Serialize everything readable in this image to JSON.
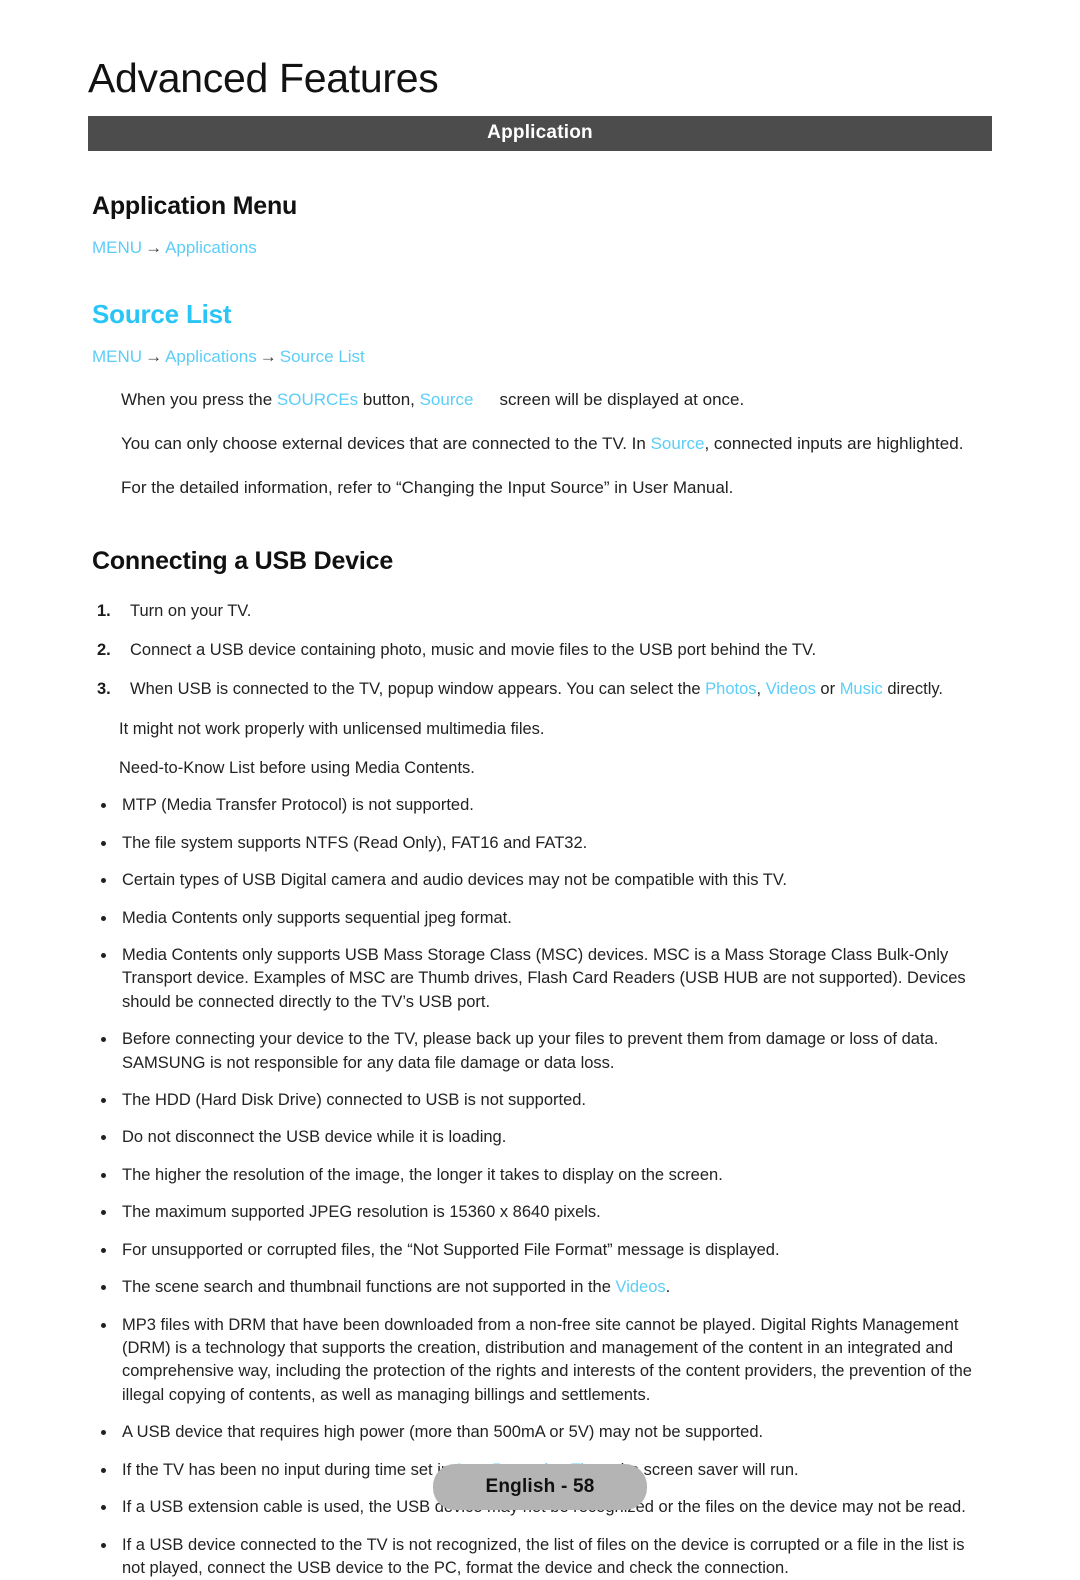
{
  "chapter": {
    "title": "Advanced Features",
    "section_bar_label": "Application"
  },
  "sections": {
    "application_menu": {
      "heading": "Application Menu",
      "menu_path": [
        "MENU",
        "Applications"
      ]
    },
    "source_list": {
      "heading": "Source List",
      "menu_path": [
        "MENU",
        "Applications",
        "Source List"
      ],
      "paragraph_1": {
        "t1": "When you press the ",
        "link1": "SOURCEs",
        "t2": " button, ",
        "link2": "Source",
        "t3": "screen will be displayed at once."
      },
      "paragraph_2": {
        "t1": "You can only choose external devices that are connected to the TV. In ",
        "link1": "Source",
        "t2": ", connected inputs are highlighted."
      },
      "paragraph_3": "For the detailed information, refer to “Changing the Input Source” in User Manual."
    },
    "connecting_usb": {
      "heading": "Connecting a USB Device",
      "steps": [
        {
          "num": "1.",
          "text": "Turn on your TV."
        },
        {
          "num": "2.",
          "text": "Connect a USB device containing photo, music and movie files to the USB port behind the TV."
        }
      ],
      "step3": {
        "num": "3.",
        "t1": "When USB is connected to the TV, popup window appears. You can select the ",
        "link1": "Photos",
        "t2": ", ",
        "link2": "Videos",
        "t3": " or ",
        "link3": "Music",
        "t4": " directly."
      },
      "subnotes": [
        "It might not work properly with unlicensed multimedia files.",
        "Need-to-Know List before using Media Contents."
      ],
      "bullets": [
        "MTP (Media Transfer Protocol) is not supported.",
        "The file system supports NTFS (Read Only), FAT16 and FAT32.",
        "Certain types of USB Digital camera and audio devices may not be compatible with this TV.",
        "Media Contents only supports sequential jpeg format.",
        "Media Contents only supports USB Mass Storage Class (MSC) devices. MSC is a Mass Storage Class Bulk-Only Transport device. Examples of MSC are Thumb drives, Flash Card Readers (USB HUB are not supported). Devices should be connected directly to the TV’s USB port.",
        "Before connecting your device to the TV, please back up your files to prevent them from damage or loss of data. SAMSUNG is not responsible for any data file damage or data loss.",
        "The HDD (Hard Disk Drive) connected to USB is not supported.",
        "Do not disconnect the USB device while it is loading.",
        "The higher the resolution of the image, the longer it takes to display on the screen.",
        "The maximum supported JPEG resolution is 15360 x 8640 pixels.",
        "For unsupported or corrupted files, the “Not Supported File Format” message is displayed."
      ],
      "bullet_videos": {
        "t1": "The scene search and thumbnail functions are not supported in the ",
        "link1": "Videos",
        "t2": "."
      },
      "bullet_drm": "MP3 files with DRM that have been downloaded from a non-free site cannot be played. Digital Rights Management (DRM) is a technology that supports the creation, distribution and management of the content in an integrated and comprehensive way, including the protection of the rights and interests of the content providers, the prevention of the illegal copying of contents, as well as managing billings and settlements.",
      "bullet_power": "A USB device that requires high power (more than 500mA or 5V) may not be supported.",
      "bullet_auto_protection": {
        "t1": "If the TV has been no input during time set in ",
        "link1": "Auto Protection Time",
        "t2": ", the screen saver will run."
      },
      "bullets_tail": [
        "If a USB extension cable is used, the USB device may not be recognized or the files on the device may not be read.",
        "If a USB device connected to the TV is not recognized, the list of files on the device is corrupted or a file in the list is not played, connect the USB device to the PC, format the device and check the connection."
      ]
    }
  },
  "footer": {
    "page_label": "English - 58"
  },
  "colors": {
    "accent_cyan": "#5ccdf7",
    "heading_cyan": "#29c5f6",
    "section_bar": "#4c4c4c",
    "page_pill": "#b4b4b4"
  }
}
